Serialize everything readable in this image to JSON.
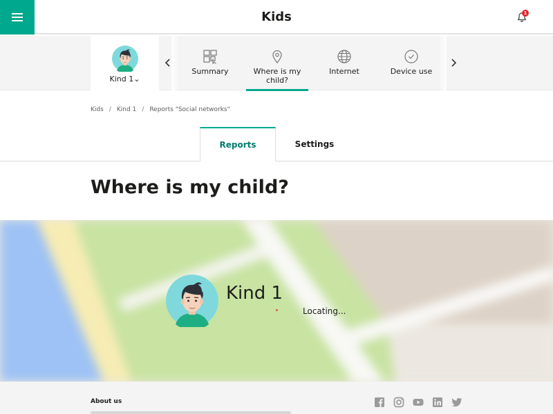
{
  "header": {
    "title": "Kids",
    "notification_count": "1"
  },
  "child_selector": {
    "name": "Kind 1"
  },
  "nav_tabs": [
    {
      "label": "Summary",
      "icon": "summary-grid-icon"
    },
    {
      "label": "Where is my child?",
      "icon": "location-pin-icon",
      "active": true
    },
    {
      "label": "Internet",
      "icon": "globe-icon"
    },
    {
      "label": "Device use",
      "icon": "clock-icon"
    }
  ],
  "breadcrumb": {
    "items": [
      "Kids",
      "Kind 1",
      "Reports \"Social networks\""
    ],
    "separator": "/"
  },
  "page_tabs": [
    {
      "label": "Reports",
      "active": true
    },
    {
      "label": "Settings"
    }
  ],
  "page_title": "Where is my child?",
  "map": {
    "child_name": "Kind 1",
    "status": "Locating..."
  },
  "footer": {
    "title": "About us",
    "social_icons": [
      "facebook-icon",
      "instagram-icon",
      "youtube-icon",
      "linkedin-icon",
      "twitter-icon"
    ]
  },
  "colors": {
    "accent": "#00a88e",
    "accent_dark": "#007d6b",
    "badge": "#e3242b",
    "map_water": "#9ec2f5",
    "map_park": "#c8e3a2",
    "map_road_yellow": "#f6ecb4",
    "map_land": "#ece8e1",
    "map_block": "#ddd2c7"
  }
}
